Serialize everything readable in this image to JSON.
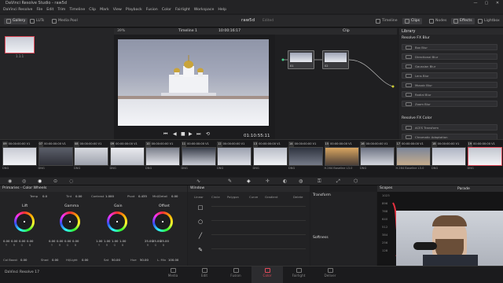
{
  "titlebar": {
    "title": "DaVinci Resolve Studio - raw5d",
    "minimize": "—",
    "maximize": "▢",
    "close": "✕"
  },
  "menu": [
    "DaVinci Resolve",
    "File",
    "Edit",
    "Trim",
    "Timeline",
    "Clip",
    "Mark",
    "View",
    "Playback",
    "Fusion",
    "Color",
    "Fairlight",
    "Workspace",
    "Help"
  ],
  "toolbar": {
    "gallery": "Gallery",
    "luts": "LUTs",
    "media_pool": "Media Pool",
    "project": "raw5d",
    "edited": "Edited",
    "timeline": "Timeline",
    "clips": "Clips",
    "nodes": "Nodes",
    "effects": "Effects",
    "lightbox": "Lightbox"
  },
  "gallery": {
    "still_label": "1.1.1"
  },
  "viewer": {
    "zoom": "39%",
    "timeline_name": "Timeline 1",
    "timecode_top": "10:00:16:17",
    "clip_mode": "Clip",
    "timecode": "01:10:55:11"
  },
  "library": {
    "header": "Library",
    "blur_section": "Resolve FX Blur",
    "blur_items": [
      "Box Blur",
      "Directional Blur",
      "Gaussian Blur",
      "Lens Blur",
      "Mosaic Blur",
      "Radial Blur",
      "Zoom Blur"
    ],
    "color_section": "Resolve FX Color",
    "color_items": [
      "ACES Transform",
      "Chromatic Adaptation"
    ]
  },
  "nodes": [
    {
      "label": "01"
    },
    {
      "label": "02"
    }
  ],
  "clips": [
    {
      "num": "09",
      "tc": "00:00:00:00",
      "track": "V1",
      "codec": "DNG",
      "sel": false
    },
    {
      "num": "07",
      "tc": "00:00:00:00",
      "track": "V1",
      "codec": "DNG",
      "sel": false
    },
    {
      "num": "08",
      "tc": "00:00:00:00",
      "track": "V1",
      "codec": "DNG",
      "sel": false
    },
    {
      "num": "09",
      "tc": "00:00:00:00",
      "track": "V1",
      "codec": "DNG",
      "sel": false
    },
    {
      "num": "10",
      "tc": "00:00:00:00",
      "track": "V1",
      "codec": "DNG",
      "sel": false
    },
    {
      "num": "11",
      "tc": "00:00:00:00",
      "track": "V1",
      "codec": "DNG",
      "sel": false
    },
    {
      "num": "12",
      "tc": "00:00:00:00",
      "track": "V1",
      "codec": "DNG",
      "sel": false
    },
    {
      "num": "13",
      "tc": "00:00:00:00",
      "track": "V1",
      "codec": "DNG",
      "sel": false
    },
    {
      "num": "14",
      "tc": "00:00:00:00",
      "track": "V1",
      "codec": "DNG",
      "sel": false
    },
    {
      "num": "15",
      "tc": "00:00:00:00",
      "track": "V1",
      "codec": "H.264 Baseline L3.0",
      "sel": false
    },
    {
      "num": "16",
      "tc": "00:00:00:00",
      "track": "V1",
      "codec": "DNG",
      "sel": false
    },
    {
      "num": "17",
      "tc": "00:00:00:00",
      "track": "V1",
      "codec": "H.264 Baseline L3.0",
      "sel": false
    },
    {
      "num": "18",
      "tc": "00:00:00:00",
      "track": "V1",
      "codec": "DNG",
      "sel": false
    },
    {
      "num": "19",
      "tc": "00:00:00:00",
      "track": "V1",
      "codec": "DNG",
      "sel": true
    }
  ],
  "primaries": {
    "header": "Primaries - Color Wheels",
    "temp_label": "Temp",
    "temp": "0.0",
    "tint_label": "Tint",
    "tint": "0.00",
    "contrast_label": "Contrast",
    "contrast": "1.000",
    "pivot_label": "Pivot",
    "pivot": "0.435",
    "middetail_label": "Mid/Detail",
    "middetail": "0.00",
    "wheels": [
      {
        "name": "Lift",
        "vals": [
          "0.00",
          "0.00",
          "0.00",
          "0.00"
        ]
      },
      {
        "name": "Gamma",
        "vals": [
          "0.00",
          "0.00",
          "0.00",
          "0.00"
        ]
      },
      {
        "name": "Gain",
        "vals": [
          "1.00",
          "1.00",
          "1.00",
          "1.00"
        ]
      },
      {
        "name": "Offset",
        "vals": [
          "25.00",
          "25.00",
          "25.00",
          ""
        ]
      }
    ],
    "channels": [
      "Y",
      "R",
      "G",
      "B"
    ],
    "col_boost_label": "Col Boost",
    "col_boost": "0.00",
    "shad_label": "Shad",
    "shad": "0.00",
    "hilight_label": "Hi/Light",
    "hilight": "0.00",
    "sat_label": "Sat",
    "sat": "50.00",
    "hue_label": "Hue",
    "hue": "50.00",
    "lmix_label": "L. Mix",
    "lmix": "100.00"
  },
  "window": {
    "header": "Window",
    "shapes": [
      "Linear",
      "Circle",
      "Polygon",
      "Curve",
      "Gradient"
    ],
    "delete": "Delete"
  },
  "transform": {
    "header": "Transform",
    "softness": "Softness"
  },
  "scopes": {
    "header": "Scopes",
    "mode": "Parade",
    "ticks": [
      "1023",
      "896",
      "768",
      "640",
      "512",
      "384",
      "256",
      "128"
    ]
  },
  "pages": [
    "Media",
    "Edit",
    "Fusion",
    "Color",
    "Fairlight",
    "Deliver"
  ],
  "active_page": "Color",
  "brand": "DaVinci Resolve 17",
  "accent": "#e04a5a"
}
